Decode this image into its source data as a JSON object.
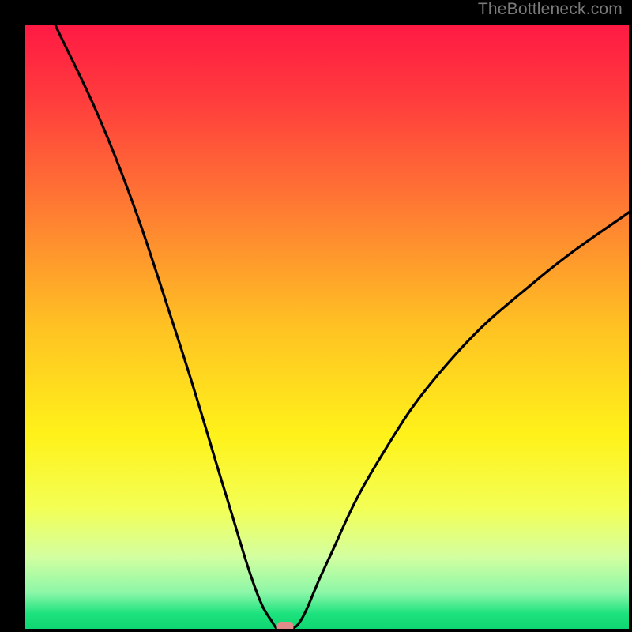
{
  "watermark": "TheBottleneck.com",
  "chart_data": {
    "type": "line",
    "title": "",
    "xlabel": "",
    "ylabel": "",
    "xlim": [
      0,
      100
    ],
    "ylim": [
      0,
      100
    ],
    "curve": {
      "description": "V-shaped bottleneck curve on vertical rainbow gradient (red top → green bottom)",
      "minimum_x": 42,
      "left_branch": [
        {
          "x": 5,
          "y": 100
        },
        {
          "x": 15,
          "y": 78
        },
        {
          "x": 25,
          "y": 49
        },
        {
          "x": 33,
          "y": 23
        },
        {
          "x": 38,
          "y": 7
        },
        {
          "x": 41,
          "y": 1
        },
        {
          "x": 42,
          "y": 0
        }
      ],
      "right_branch": [
        {
          "x": 44,
          "y": 0
        },
        {
          "x": 46,
          "y": 2
        },
        {
          "x": 50,
          "y": 11
        },
        {
          "x": 58,
          "y": 27
        },
        {
          "x": 70,
          "y": 44
        },
        {
          "x": 85,
          "y": 58
        },
        {
          "x": 100,
          "y": 69
        }
      ]
    },
    "marker": {
      "x": 43,
      "y": 0,
      "color": "#e28b8b"
    },
    "gradient_stops": [
      {
        "offset": 0.0,
        "color": "#ff1a44"
      },
      {
        "offset": 0.12,
        "color": "#ff3b3d"
      },
      {
        "offset": 0.3,
        "color": "#ff7a33"
      },
      {
        "offset": 0.5,
        "color": "#ffc223"
      },
      {
        "offset": 0.68,
        "color": "#fff21a"
      },
      {
        "offset": 0.8,
        "color": "#f3ff55"
      },
      {
        "offset": 0.88,
        "color": "#d4ffa0"
      },
      {
        "offset": 0.94,
        "color": "#8cf7a8"
      },
      {
        "offset": 0.975,
        "color": "#1de27e"
      },
      {
        "offset": 1.0,
        "color": "#0fd672"
      }
    ]
  }
}
